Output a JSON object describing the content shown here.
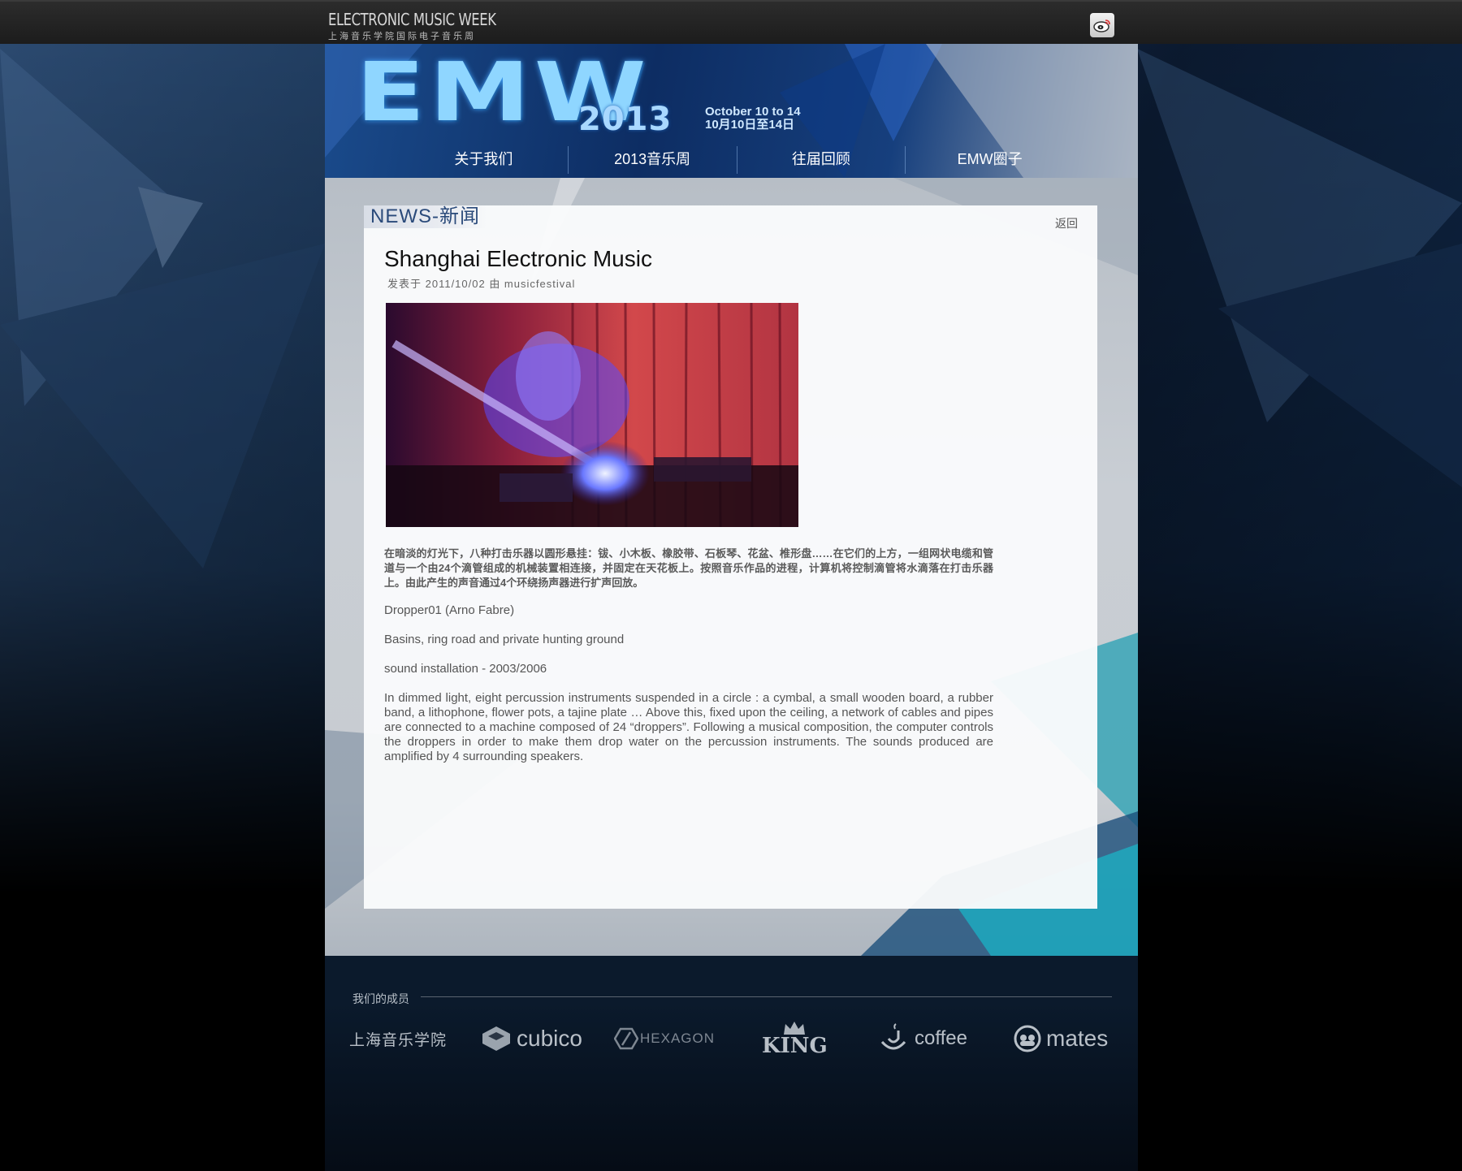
{
  "topbar": {
    "brand_en": "ELECTRONIC MUSIC WEEK",
    "brand_cn": "上海音乐学院国际电子音乐周"
  },
  "header": {
    "logo_letters": "EMW",
    "year": "2013",
    "date_en": "October 10 to 14",
    "date_cn": "10月10日至14日"
  },
  "nav": {
    "items": [
      "关于我们",
      "2013音乐周",
      "往届回顾",
      "EMW圈子"
    ]
  },
  "news": {
    "tag": "NEWS-新闻",
    "back": "返回",
    "title": "Shanghai  Electronic Music",
    "byline": "发表于 2011/10/02 由 musicfestival",
    "para_cn": "在暗淡的灯光下，八种打击乐器以圆形悬挂：钹、小木板、橡胶带、石板琴、花盆、椎形盘……在它们的上方，一组网状电缆和管道与一个由24个滴管组成的机械装置相连接，并固定在天花板上。按照音乐作品的进程，计算机将控制滴管将水滴落在打击乐器上。由此产生的声音通过4个环绕扬声器进行扩声回放。",
    "line1": "Dropper01 (Arno Fabre)",
    "line2": "Basins, ring road and private hunting ground",
    "line3": "sound installation  -  2003/2006",
    "para_en": "In dimmed light, eight percussion instruments suspended in a circle : a cymbal, a small wooden board, a rubber band, a lithophone, flower pots, a tajine plate … Above this, fixed upon the ceiling, a network of cables and pipes are connected to a machine composed of 24 “droppers”. Following a musical composition, the computer controls the droppers in order to make them drop water on the percussion instruments. The sounds produced are amplified by 4 surrounding speakers."
  },
  "footer": {
    "members_label": "我们的成员",
    "partners": [
      "上海音乐学院",
      "cubico",
      "HEXAGON",
      "KING",
      "coffee",
      "mates"
    ]
  },
  "colors": {
    "accent_blue": "#2a4a7a",
    "topbar": "#222222"
  }
}
